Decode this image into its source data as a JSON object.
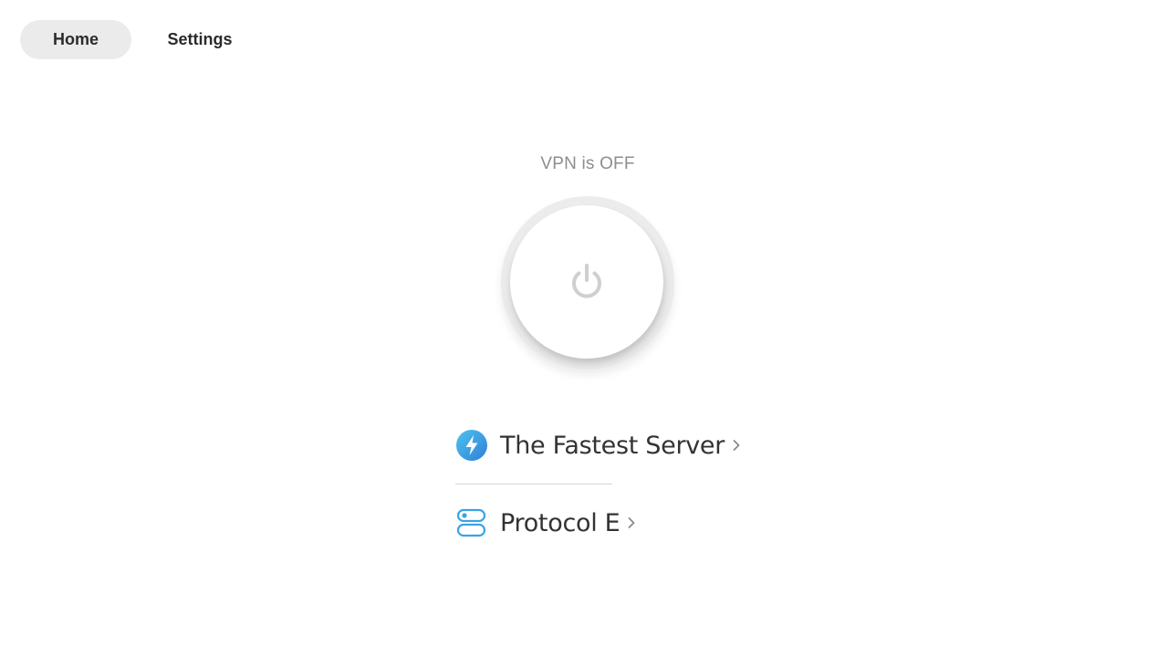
{
  "nav": {
    "tabs": [
      {
        "label": "Home",
        "active": true
      },
      {
        "label": "Settings",
        "active": false
      }
    ]
  },
  "vpn": {
    "status_text": "VPN is OFF",
    "power_icon": "power-icon"
  },
  "server": {
    "icon": "lightning-bolt-icon",
    "label": "The Fastest Server",
    "chevron": "chevron-right-icon"
  },
  "protocol": {
    "icon": "protocol-toggle-icon",
    "label": "Protocol E",
    "chevron": "chevron-right-icon"
  },
  "colors": {
    "accent_blue": "#3aa3e3",
    "status_gray": "#8e8e8e",
    "tab_active_bg": "#ebebeb"
  }
}
